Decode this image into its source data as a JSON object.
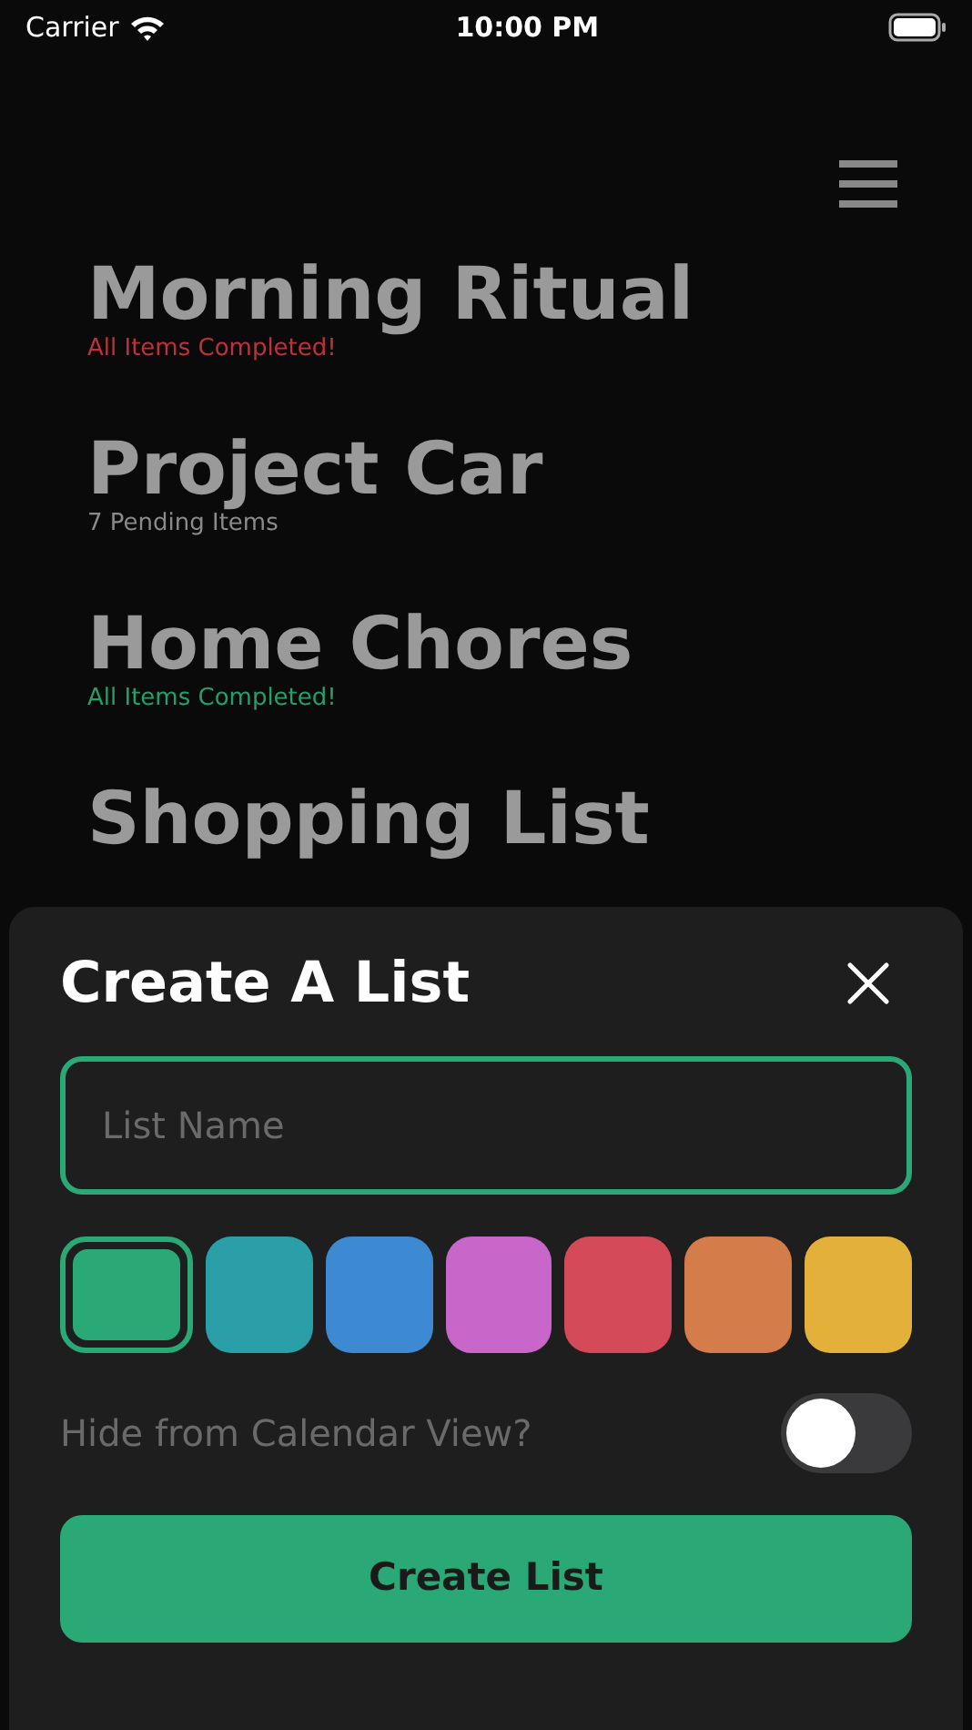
{
  "status_bar": {
    "carrier": "Carrier",
    "time": "10:00 PM"
  },
  "lists": [
    {
      "title": "Morning Ritual",
      "subtitle": "All Items Completed!",
      "color": "#c0303a"
    },
    {
      "title": "Project Car",
      "subtitle": "7 Pending Items",
      "color": "#8a8a8a"
    },
    {
      "title": "Home Chores",
      "subtitle": "All Items Completed!",
      "color": "#22a06a"
    },
    {
      "title": "Shopping List"
    }
  ],
  "sheet": {
    "title": "Create A List",
    "name_field": {
      "placeholder": "List Name"
    },
    "swatches": [
      {
        "color": "#2aa876",
        "selected": true
      },
      {
        "color": "#2a9fa8",
        "selected": false
      },
      {
        "color": "#3d8ad3",
        "selected": false
      },
      {
        "color": "#c966c9",
        "selected": false
      },
      {
        "color": "#d54a58",
        "selected": false
      },
      {
        "color": "#d47c4a",
        "selected": false
      },
      {
        "color": "#e3b03a",
        "selected": false
      }
    ],
    "hide_toggle": {
      "label": "Hide from Calendar View?",
      "on": false
    },
    "create_button": "Create List"
  }
}
